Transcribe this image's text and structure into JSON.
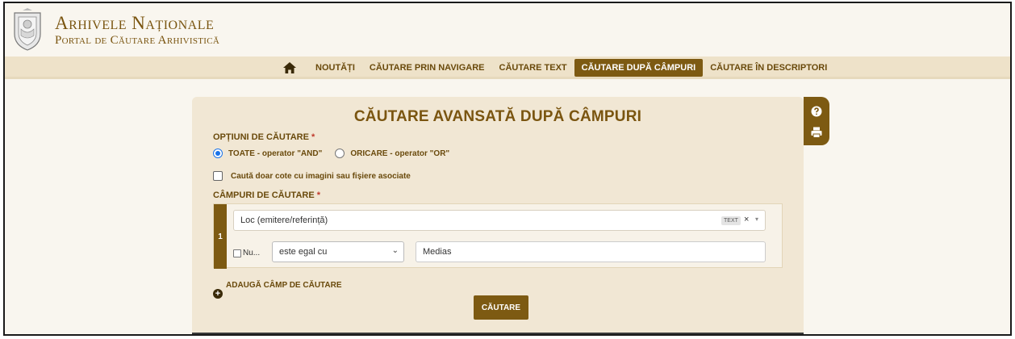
{
  "brand": {
    "title": "Arhivele Naționale",
    "subtitle": "Portal de Căutare Arhivistică",
    "accent": "#7a5510"
  },
  "nav": {
    "home_icon": "home-icon",
    "items": [
      {
        "label": "NOUTĂȚI",
        "active": false
      },
      {
        "label": "CĂUTARE PRIN NAVIGARE",
        "active": false
      },
      {
        "label": "CĂUTARE TEXT",
        "active": false
      },
      {
        "label": "CĂUTARE DUPĂ CÂMPURI",
        "active": true
      },
      {
        "label": "CĂUTARE ÎN DESCRIPTORI",
        "active": false
      }
    ]
  },
  "card": {
    "title": "CĂUTARE AVANSATĂ DUPĂ CÂMPURI",
    "tools": [
      "help-icon",
      "print-icon"
    ],
    "options_label": "OPȚIUNI DE CĂUTARE",
    "required_mark": "*",
    "radio_and": "TOATE - operator \"AND\"",
    "radio_or": "ORICARE - operator \"OR\"",
    "selected_operator": "AND",
    "images_only_label": "Caută doar cote cu imagini sau fișiere asociate",
    "fields_label": "CÂMPURI DE CĂUTARE",
    "field_row": {
      "index": "1",
      "field_value": "Loc (emitere/referință)",
      "field_badge": "TEXT",
      "clear": "×",
      "caret": "▾",
      "negate_label": "Nu...",
      "operator_value": "este egal cu",
      "operator_chevron": "⌄",
      "search_value": "Medias"
    },
    "add_field_label": "ADAUGĂ CÂMP DE CĂUTARE",
    "add_icon": "+",
    "search_button": "CĂUTARE"
  }
}
